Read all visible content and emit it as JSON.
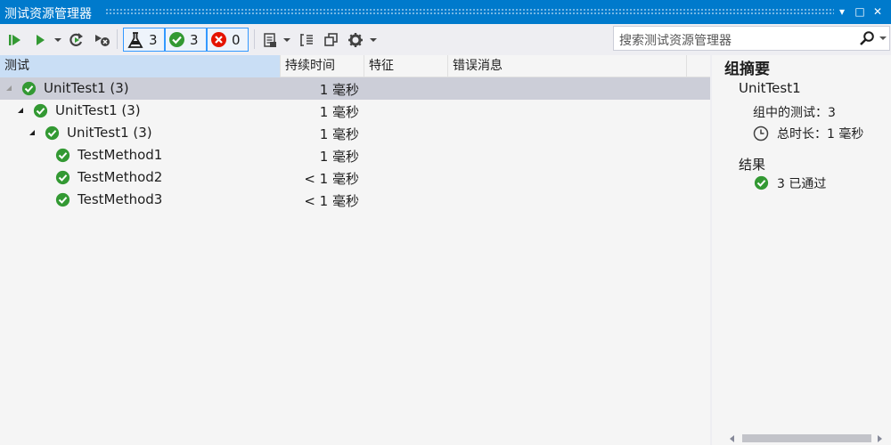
{
  "window": {
    "title": "测试资源管理器",
    "controls": [
      "▾",
      "□",
      "✕"
    ]
  },
  "toolbar": {
    "run_all_icon": "run-all-icon",
    "run_icon": "run-icon",
    "refresh_icon": "refresh-icon",
    "cancel_icon": "cancel-icon",
    "total_count": "3",
    "passed_count": "3",
    "failed_count": "0",
    "search_placeholder": "搜索测试资源管理器"
  },
  "columns": [
    "测试",
    "持续时间",
    "特征",
    "错误消息"
  ],
  "rows": [
    {
      "name": "UnitTest1",
      "count": "(3)",
      "duration": "1 毫秒"
    },
    {
      "name": "UnitTest1",
      "count": "(3)",
      "duration": "1 毫秒"
    },
    {
      "name": "UnitTest1",
      "count": "(3)",
      "duration": "1 毫秒"
    },
    {
      "name": "TestMethod1",
      "count": "",
      "duration": "1 毫秒"
    },
    {
      "name": "TestMethod2",
      "count": "",
      "duration": "< 1 毫秒"
    },
    {
      "name": "TestMethod3",
      "count": "",
      "duration": "< 1 毫秒"
    }
  ],
  "summary": {
    "header": "组摘要",
    "group_name": "UnitTest1",
    "tests_in_group": "组中的测试：3",
    "total_duration": "总时长：1 毫秒",
    "results_label": "结果",
    "passed_text": "3 已通过"
  },
  "colors": {
    "accent": "#007acc",
    "pass": "#339933",
    "fail": "#e51400",
    "selection": "#ccced8"
  }
}
